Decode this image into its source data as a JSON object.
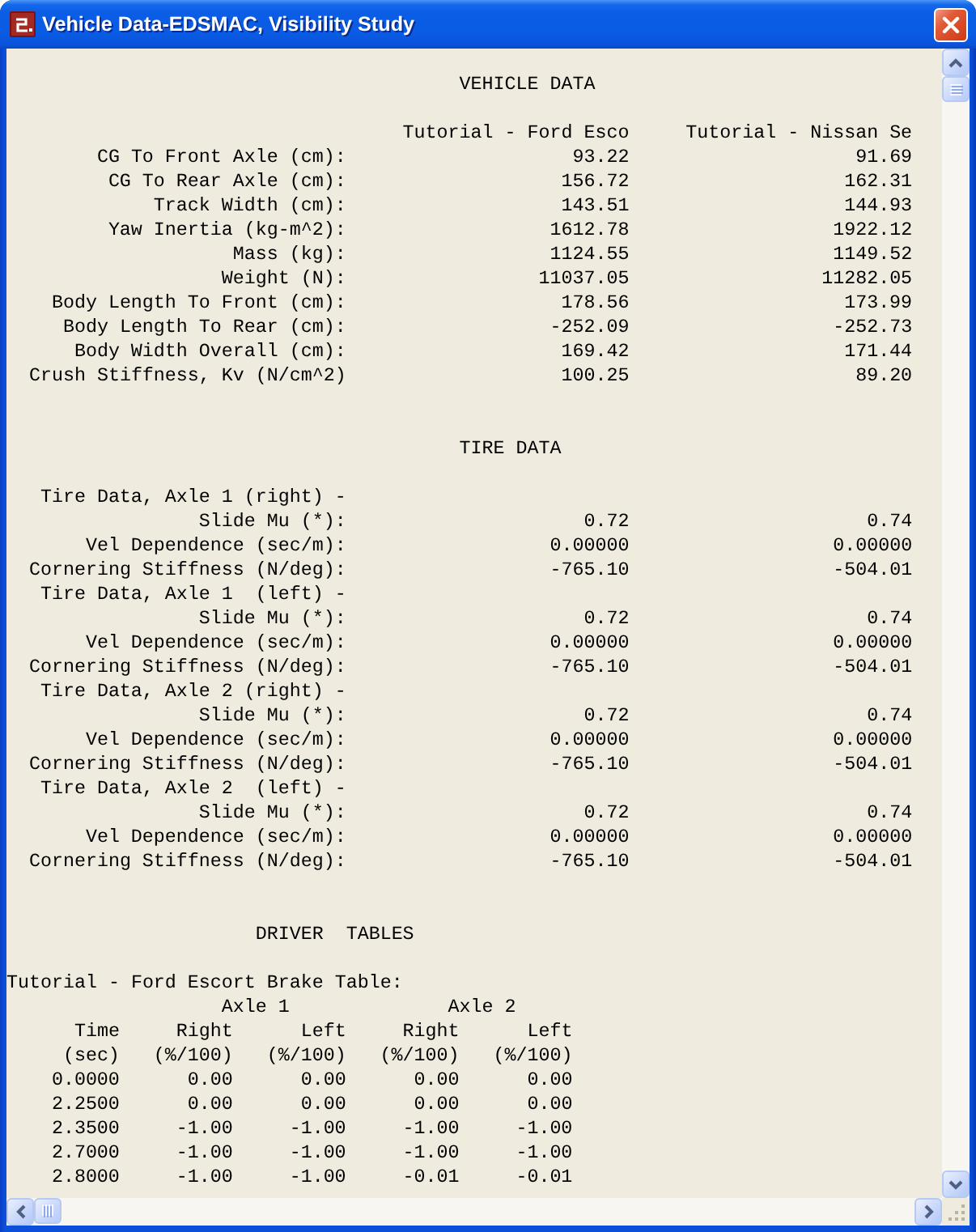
{
  "window": {
    "title": "Vehicle Data-EDSMAC, Visibility Study"
  },
  "vehicle_data": {
    "heading": "VEHICLE DATA",
    "columns": [
      "Tutorial - Ford Esco",
      "Tutorial - Nissan Se"
    ],
    "rows": [
      {
        "label": "CG To Front Axle (cm):",
        "values": [
          "93.22",
          "91.69"
        ]
      },
      {
        "label": "CG To Rear Axle (cm):",
        "values": [
          "156.72",
          "162.31"
        ]
      },
      {
        "label": "Track Width (cm):",
        "values": [
          "143.51",
          "144.93"
        ]
      },
      {
        "label": "Yaw Inertia (kg-m^2):",
        "values": [
          "1612.78",
          "1922.12"
        ]
      },
      {
        "label": "Mass (kg):",
        "values": [
          "1124.55",
          "1149.52"
        ]
      },
      {
        "label": "Weight (N):",
        "values": [
          "11037.05",
          "11282.05"
        ]
      },
      {
        "label": "Body Length To Front (cm):",
        "values": [
          "178.56",
          "173.99"
        ]
      },
      {
        "label": "Body Length To Rear (cm):",
        "values": [
          "-252.09",
          "-252.73"
        ]
      },
      {
        "label": "Body Width Overall (cm):",
        "values": [
          "169.42",
          "171.44"
        ]
      },
      {
        "label": "Crush Stiffness, Kv (N/cm^2)",
        "values": [
          "100.25",
          "89.20"
        ]
      }
    ]
  },
  "tire_data": {
    "heading": "TIRE DATA",
    "groups": [
      {
        "title": "Tire Data, Axle 1 (right) -",
        "rows": [
          {
            "label": "Slide Mu (*):",
            "values": [
              "0.72",
              "0.74"
            ]
          },
          {
            "label": "Vel Dependence (sec/m):",
            "values": [
              "0.00000",
              "0.00000"
            ]
          },
          {
            "label": "Cornering Stiffness (N/deg):",
            "values": [
              "-765.10",
              "-504.01"
            ]
          }
        ]
      },
      {
        "title": "Tire Data, Axle 1  (left) -",
        "rows": [
          {
            "label": "Slide Mu (*):",
            "values": [
              "0.72",
              "0.74"
            ]
          },
          {
            "label": "Vel Dependence (sec/m):",
            "values": [
              "0.00000",
              "0.00000"
            ]
          },
          {
            "label": "Cornering Stiffness (N/deg):",
            "values": [
              "-765.10",
              "-504.01"
            ]
          }
        ]
      },
      {
        "title": "Tire Data, Axle 2 (right) -",
        "rows": [
          {
            "label": "Slide Mu (*):",
            "values": [
              "0.72",
              "0.74"
            ]
          },
          {
            "label": "Vel Dependence (sec/m):",
            "values": [
              "0.00000",
              "0.00000"
            ]
          },
          {
            "label": "Cornering Stiffness (N/deg):",
            "values": [
              "-765.10",
              "-504.01"
            ]
          }
        ]
      },
      {
        "title": "Tire Data, Axle 2  (left) -",
        "rows": [
          {
            "label": "Slide Mu (*):",
            "values": [
              "0.72",
              "0.74"
            ]
          },
          {
            "label": "Vel Dependence (sec/m):",
            "values": [
              "0.00000",
              "0.00000"
            ]
          },
          {
            "label": "Cornering Stiffness (N/deg):",
            "values": [
              "-765.10",
              "-504.01"
            ]
          }
        ]
      }
    ]
  },
  "driver_tables": {
    "heading": "DRIVER  TABLES",
    "tables": [
      {
        "title": "Tutorial - Ford Escort Brake Table:",
        "groups": [
          "Axle 1",
          "Axle 2"
        ],
        "columns": [
          {
            "name": "Time",
            "unit": "(sec)"
          },
          {
            "name": "Right",
            "unit": "(%/100)"
          },
          {
            "name": "Left",
            "unit": "(%/100)"
          },
          {
            "name": "Right",
            "unit": "(%/100)"
          },
          {
            "name": "Left",
            "unit": "(%/100)"
          }
        ],
        "rows": [
          [
            "0.0000",
            "0.00",
            "0.00",
            "0.00",
            "0.00"
          ],
          [
            "2.2500",
            "0.00",
            "0.00",
            "0.00",
            "0.00"
          ],
          [
            "2.3500",
            "-1.00",
            "-1.00",
            "-1.00",
            "-1.00"
          ],
          [
            "2.7000",
            "-1.00",
            "-1.00",
            "-1.00",
            "-1.00"
          ],
          [
            "2.8000",
            "-1.00",
            "-1.00",
            "-0.01",
            "-0.01"
          ]
        ]
      }
    ]
  }
}
